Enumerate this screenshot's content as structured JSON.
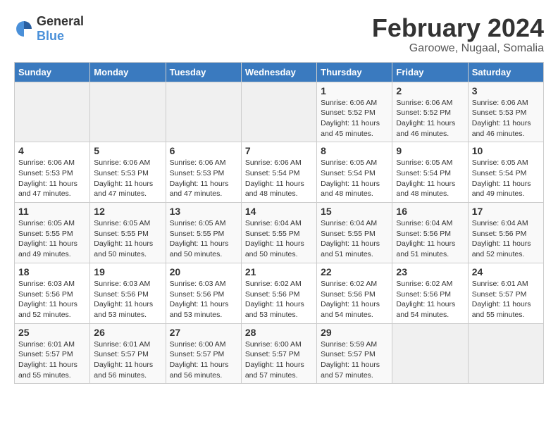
{
  "logo": {
    "general": "General",
    "blue": "Blue"
  },
  "title": "February 2024",
  "subtitle": "Garoowe, Nugaal, Somalia",
  "days_header": [
    "Sunday",
    "Monday",
    "Tuesday",
    "Wednesday",
    "Thursday",
    "Friday",
    "Saturday"
  ],
  "weeks": [
    [
      {
        "num": "",
        "info": ""
      },
      {
        "num": "",
        "info": ""
      },
      {
        "num": "",
        "info": ""
      },
      {
        "num": "",
        "info": ""
      },
      {
        "num": "1",
        "info": "Sunrise: 6:06 AM\nSunset: 5:52 PM\nDaylight: 11 hours\nand 45 minutes."
      },
      {
        "num": "2",
        "info": "Sunrise: 6:06 AM\nSunset: 5:52 PM\nDaylight: 11 hours\nand 46 minutes."
      },
      {
        "num": "3",
        "info": "Sunrise: 6:06 AM\nSunset: 5:53 PM\nDaylight: 11 hours\nand 46 minutes."
      }
    ],
    [
      {
        "num": "4",
        "info": "Sunrise: 6:06 AM\nSunset: 5:53 PM\nDaylight: 11 hours\nand 47 minutes."
      },
      {
        "num": "5",
        "info": "Sunrise: 6:06 AM\nSunset: 5:53 PM\nDaylight: 11 hours\nand 47 minutes."
      },
      {
        "num": "6",
        "info": "Sunrise: 6:06 AM\nSunset: 5:53 PM\nDaylight: 11 hours\nand 47 minutes."
      },
      {
        "num": "7",
        "info": "Sunrise: 6:06 AM\nSunset: 5:54 PM\nDaylight: 11 hours\nand 48 minutes."
      },
      {
        "num": "8",
        "info": "Sunrise: 6:05 AM\nSunset: 5:54 PM\nDaylight: 11 hours\nand 48 minutes."
      },
      {
        "num": "9",
        "info": "Sunrise: 6:05 AM\nSunset: 5:54 PM\nDaylight: 11 hours\nand 48 minutes."
      },
      {
        "num": "10",
        "info": "Sunrise: 6:05 AM\nSunset: 5:54 PM\nDaylight: 11 hours\nand 49 minutes."
      }
    ],
    [
      {
        "num": "11",
        "info": "Sunrise: 6:05 AM\nSunset: 5:55 PM\nDaylight: 11 hours\nand 49 minutes."
      },
      {
        "num": "12",
        "info": "Sunrise: 6:05 AM\nSunset: 5:55 PM\nDaylight: 11 hours\nand 50 minutes."
      },
      {
        "num": "13",
        "info": "Sunrise: 6:05 AM\nSunset: 5:55 PM\nDaylight: 11 hours\nand 50 minutes."
      },
      {
        "num": "14",
        "info": "Sunrise: 6:04 AM\nSunset: 5:55 PM\nDaylight: 11 hours\nand 50 minutes."
      },
      {
        "num": "15",
        "info": "Sunrise: 6:04 AM\nSunset: 5:55 PM\nDaylight: 11 hours\nand 51 minutes."
      },
      {
        "num": "16",
        "info": "Sunrise: 6:04 AM\nSunset: 5:56 PM\nDaylight: 11 hours\nand 51 minutes."
      },
      {
        "num": "17",
        "info": "Sunrise: 6:04 AM\nSunset: 5:56 PM\nDaylight: 11 hours\nand 52 minutes."
      }
    ],
    [
      {
        "num": "18",
        "info": "Sunrise: 6:03 AM\nSunset: 5:56 PM\nDaylight: 11 hours\nand 52 minutes."
      },
      {
        "num": "19",
        "info": "Sunrise: 6:03 AM\nSunset: 5:56 PM\nDaylight: 11 hours\nand 53 minutes."
      },
      {
        "num": "20",
        "info": "Sunrise: 6:03 AM\nSunset: 5:56 PM\nDaylight: 11 hours\nand 53 minutes."
      },
      {
        "num": "21",
        "info": "Sunrise: 6:02 AM\nSunset: 5:56 PM\nDaylight: 11 hours\nand 53 minutes."
      },
      {
        "num": "22",
        "info": "Sunrise: 6:02 AM\nSunset: 5:56 PM\nDaylight: 11 hours\nand 54 minutes."
      },
      {
        "num": "23",
        "info": "Sunrise: 6:02 AM\nSunset: 5:56 PM\nDaylight: 11 hours\nand 54 minutes."
      },
      {
        "num": "24",
        "info": "Sunrise: 6:01 AM\nSunset: 5:57 PM\nDaylight: 11 hours\nand 55 minutes."
      }
    ],
    [
      {
        "num": "25",
        "info": "Sunrise: 6:01 AM\nSunset: 5:57 PM\nDaylight: 11 hours\nand 55 minutes."
      },
      {
        "num": "26",
        "info": "Sunrise: 6:01 AM\nSunset: 5:57 PM\nDaylight: 11 hours\nand 56 minutes."
      },
      {
        "num": "27",
        "info": "Sunrise: 6:00 AM\nSunset: 5:57 PM\nDaylight: 11 hours\nand 56 minutes."
      },
      {
        "num": "28",
        "info": "Sunrise: 6:00 AM\nSunset: 5:57 PM\nDaylight: 11 hours\nand 57 minutes."
      },
      {
        "num": "29",
        "info": "Sunrise: 5:59 AM\nSunset: 5:57 PM\nDaylight: 11 hours\nand 57 minutes."
      },
      {
        "num": "",
        "info": ""
      },
      {
        "num": "",
        "info": ""
      }
    ]
  ]
}
